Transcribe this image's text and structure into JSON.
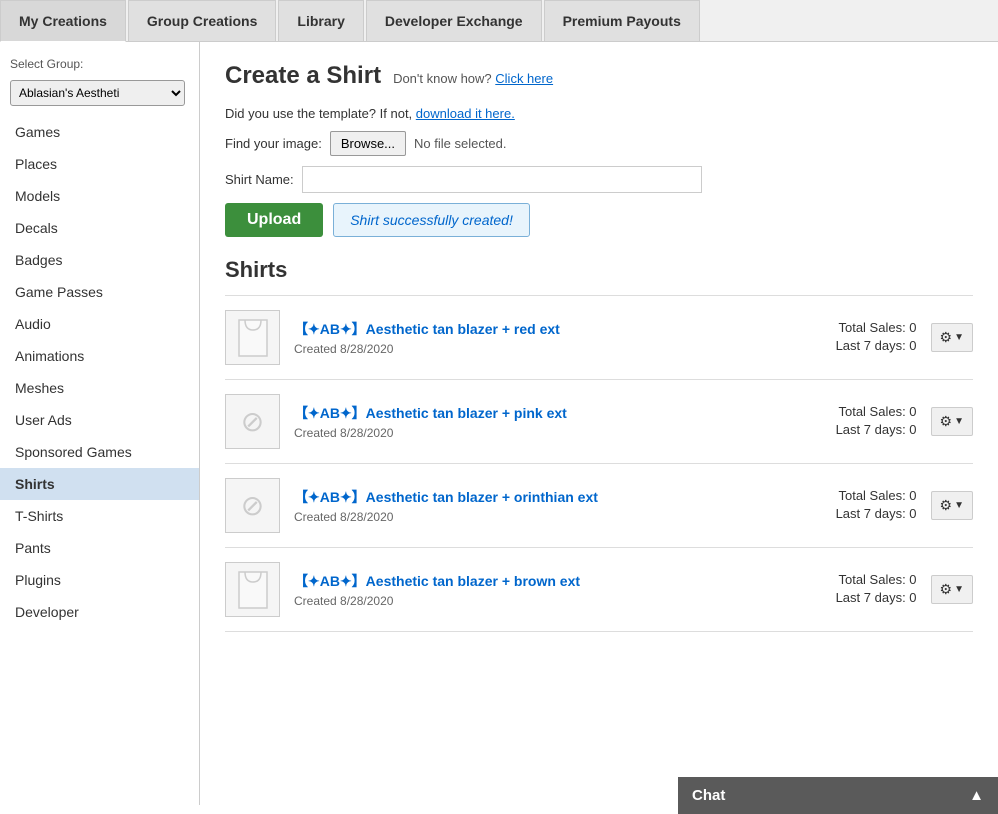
{
  "tabs": [
    {
      "id": "my-creations",
      "label": "My Creations",
      "active": true
    },
    {
      "id": "group-creations",
      "label": "Group Creations",
      "active": false
    },
    {
      "id": "library",
      "label": "Library",
      "active": false
    },
    {
      "id": "developer-exchange",
      "label": "Developer Exchange",
      "active": false
    },
    {
      "id": "premium-payouts",
      "label": "Premium Payouts",
      "active": false
    }
  ],
  "sidebar": {
    "select_group_label": "Select Group:",
    "group_value": "Ablasian's Aestheti",
    "items": [
      {
        "id": "games",
        "label": "Games",
        "active": false
      },
      {
        "id": "places",
        "label": "Places",
        "active": false
      },
      {
        "id": "models",
        "label": "Models",
        "active": false
      },
      {
        "id": "decals",
        "label": "Decals",
        "active": false
      },
      {
        "id": "badges",
        "label": "Badges",
        "active": false
      },
      {
        "id": "game-passes",
        "label": "Game Passes",
        "active": false
      },
      {
        "id": "audio",
        "label": "Audio",
        "active": false
      },
      {
        "id": "animations",
        "label": "Animations",
        "active": false
      },
      {
        "id": "meshes",
        "label": "Meshes",
        "active": false
      },
      {
        "id": "user-ads",
        "label": "User Ads",
        "active": false
      },
      {
        "id": "sponsored-games",
        "label": "Sponsored Games",
        "active": false
      },
      {
        "id": "shirts",
        "label": "Shirts",
        "active": true
      },
      {
        "id": "t-shirts",
        "label": "T-Shirts",
        "active": false
      },
      {
        "id": "pants",
        "label": "Pants",
        "active": false
      },
      {
        "id": "plugins",
        "label": "Plugins",
        "active": false
      },
      {
        "id": "developer",
        "label": "Developer",
        "active": false
      }
    ]
  },
  "main": {
    "create_title": "Create a Shirt",
    "hint_prefix": "Don't know how?",
    "hint_link": "Click here",
    "template_text": "Did you use the template? If not,",
    "template_link": "download it here.",
    "find_image_label": "Find your image:",
    "browse_label": "Browse...",
    "no_file_label": "No file selected.",
    "shirt_name_label": "Shirt Name:",
    "shirt_name_placeholder": "",
    "upload_label": "Upload",
    "success_label": "Shirt successfully created!",
    "section_title": "Shirts",
    "shirts": [
      {
        "id": 1,
        "name": "【✦AB✦】Aesthetic tan blazer + red ext",
        "created": "Created  8/28/2020",
        "total_sales": "Total Sales: 0",
        "last7": "Last 7 days: 0"
      },
      {
        "id": 2,
        "name": "【✦AB✦】Aesthetic tan blazer + pink ext",
        "created": "Created  8/28/2020",
        "total_sales": "Total Sales: 0",
        "last7": "Last 7 days: 0"
      },
      {
        "id": 3,
        "name": "【✦AB✦】Aesthetic tan blazer + orinthian ext",
        "created": "Created  8/28/2020",
        "total_sales": "Total Sales: 0",
        "last7": "Last 7 days: 0"
      },
      {
        "id": 4,
        "name": "【✦AB✦】Aesthetic tan blazer + brown ext",
        "created": "Created  8/28/2020",
        "total_sales": "Total Sales: 0",
        "last7": "Last 7 days: 0"
      }
    ]
  },
  "chat": {
    "label": "Chat"
  }
}
